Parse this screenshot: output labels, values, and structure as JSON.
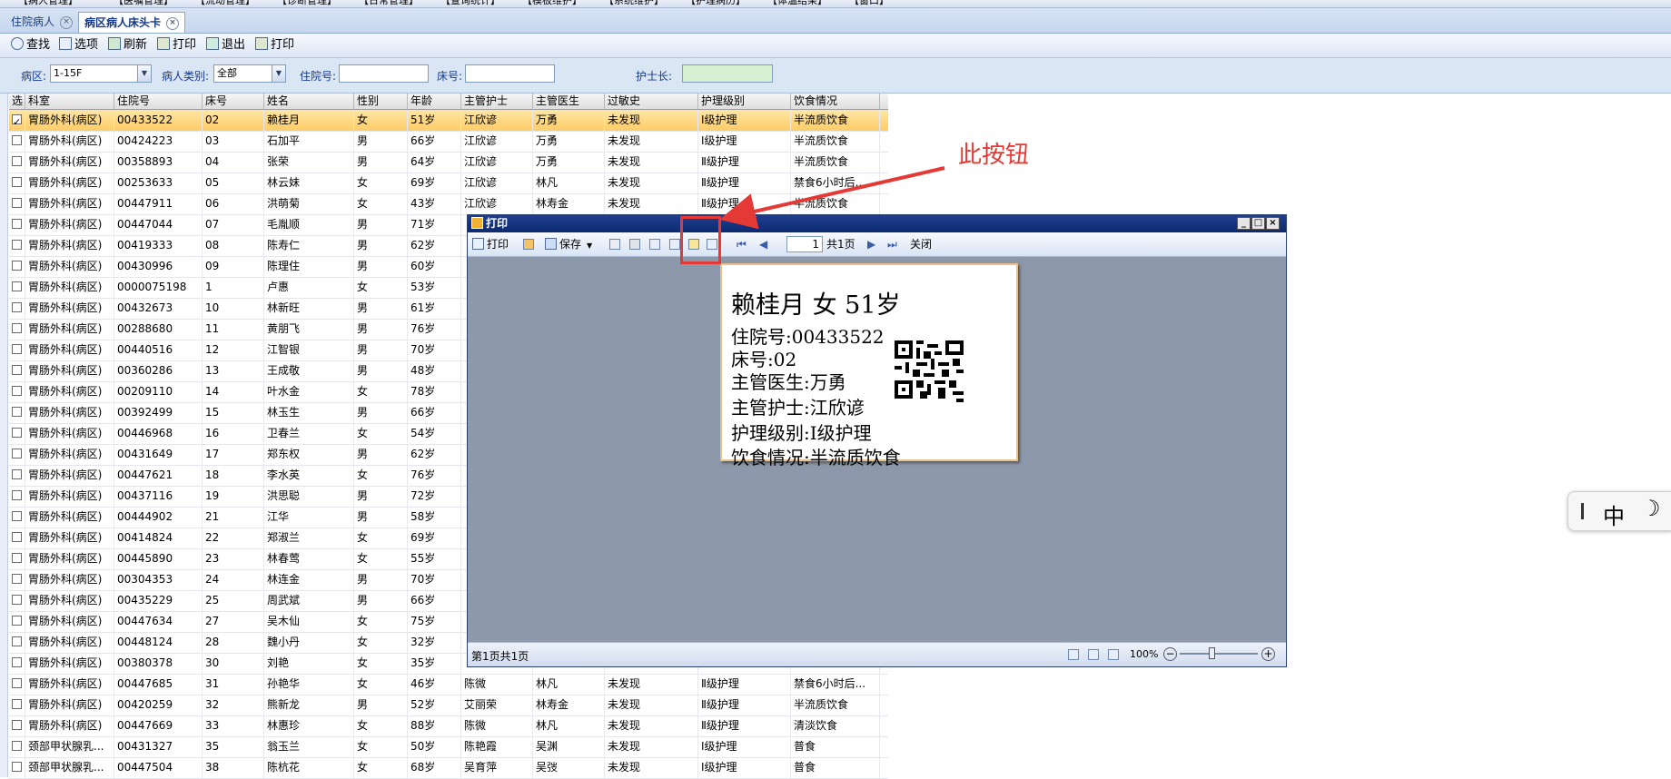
{
  "menubar": {
    "items": [
      "【病人管理】",
      "【医嘱管理】",
      "【流动管理】",
      "【诊断管理】",
      "【日常管理】",
      "【查询统计】",
      "【模板维护】",
      "【系统维护】",
      "【护理病历】",
      "【体温结果】",
      "【窗口】"
    ]
  },
  "tabs": [
    {
      "label": "住院病人",
      "active": false
    },
    {
      "label": "病区病人床头卡",
      "active": true
    }
  ],
  "toolbar": {
    "find": "查找",
    "options": "选项",
    "refresh": "刷新",
    "print1": "打印",
    "exit": "退出",
    "print2": "打印"
  },
  "filters": {
    "ward_label": "病区:",
    "ward_value": "1-15F",
    "type_label": "病人类别:",
    "type_value": "全部",
    "admission_label": "住院号:",
    "admission_value": "",
    "bed_label": "床号:",
    "bed_value": "",
    "head_nurse_label": "护士长:",
    "head_nurse_value": ""
  },
  "grid": {
    "columns": [
      "选",
      "科室",
      "住院号",
      "床号",
      "姓名",
      "性别",
      "年龄",
      "主管护士",
      "主管医生",
      "过敏史",
      "护理级别",
      "饮食情况"
    ],
    "rows": [
      {
        "checked": true,
        "cells": [
          "胃肠外科(病区)",
          "00433522",
          "02",
          "赖桂月",
          "女",
          "51岁",
          "江欣谚",
          "万勇",
          "未发现",
          "Ⅰ级护理",
          "半流质饮食"
        ]
      },
      {
        "checked": false,
        "cells": [
          "胃肠外科(病区)",
          "00424223",
          "03",
          "石加平",
          "男",
          "66岁",
          "江欣谚",
          "万勇",
          "未发现",
          "Ⅰ级护理",
          "半流质饮食"
        ]
      },
      {
        "checked": false,
        "cells": [
          "胃肠外科(病区)",
          "00358893",
          "04",
          "张荣",
          "男",
          "64岁",
          "江欣谚",
          "万勇",
          "未发现",
          "Ⅱ级护理",
          "半流质饮食"
        ]
      },
      {
        "checked": false,
        "cells": [
          "胃肠外科(病区)",
          "00253633",
          "05",
          "林云妹",
          "女",
          "69岁",
          "江欣谚",
          "林凡",
          "未发现",
          "Ⅱ级护理",
          "禁食6小时后..."
        ]
      },
      {
        "checked": false,
        "cells": [
          "胃肠外科(病区)",
          "00447911",
          "06",
          "洪萌菊",
          "女",
          "43岁",
          "江欣谚",
          "林寿金",
          "未发现",
          "Ⅱ级护理",
          "半流质饮食"
        ]
      },
      {
        "checked": false,
        "cells": [
          "胃肠外科(病区)",
          "00447044",
          "07",
          "毛胤顺",
          "男",
          "71岁",
          "",
          "",
          "",
          "",
          ""
        ]
      },
      {
        "checked": false,
        "cells": [
          "胃肠外科(病区)",
          "00419333",
          "08",
          "陈寿仁",
          "男",
          "62岁",
          "",
          "",
          "",
          "",
          ""
        ]
      },
      {
        "checked": false,
        "cells": [
          "胃肠外科(病区)",
          "00430996",
          "09",
          "陈理住",
          "男",
          "60岁",
          "",
          "",
          "",
          "",
          ""
        ]
      },
      {
        "checked": false,
        "cells": [
          "胃肠外科(病区)",
          "0000075198",
          "1",
          "卢惠",
          "女",
          "53岁",
          "",
          "",
          "",
          "",
          ""
        ]
      },
      {
        "checked": false,
        "cells": [
          "胃肠外科(病区)",
          "00432673",
          "10",
          "林新旺",
          "男",
          "61岁",
          "",
          "",
          "",
          "",
          ""
        ]
      },
      {
        "checked": false,
        "cells": [
          "胃肠外科(病区)",
          "00288680",
          "11",
          "黄朋飞",
          "男",
          "76岁",
          "",
          "",
          "",
          "",
          ""
        ]
      },
      {
        "checked": false,
        "cells": [
          "胃肠外科(病区)",
          "00440516",
          "12",
          "江智银",
          "男",
          "70岁",
          "",
          "",
          "",
          "",
          ""
        ]
      },
      {
        "checked": false,
        "cells": [
          "胃肠外科(病区)",
          "00360286",
          "13",
          "王成敬",
          "男",
          "48岁",
          "",
          "",
          "",
          "",
          ""
        ]
      },
      {
        "checked": false,
        "cells": [
          "胃肠外科(病区)",
          "00209110",
          "14",
          "叶水金",
          "女",
          "78岁",
          "",
          "",
          "",
          "",
          ""
        ]
      },
      {
        "checked": false,
        "cells": [
          "胃肠外科(病区)",
          "00392499",
          "15",
          "林玉生",
          "男",
          "66岁",
          "",
          "",
          "",
          "",
          ""
        ]
      },
      {
        "checked": false,
        "cells": [
          "胃肠外科(病区)",
          "00446968",
          "16",
          "卫春兰",
          "女",
          "54岁",
          "",
          "",
          "",
          "",
          ""
        ]
      },
      {
        "checked": false,
        "cells": [
          "胃肠外科(病区)",
          "00431649",
          "17",
          "郑东权",
          "男",
          "62岁",
          "",
          "",
          "",
          "",
          ""
        ]
      },
      {
        "checked": false,
        "cells": [
          "胃肠外科(病区)",
          "00447621",
          "18",
          "李水英",
          "女",
          "76岁",
          "",
          "",
          "",
          "",
          ""
        ]
      },
      {
        "checked": false,
        "cells": [
          "胃肠外科(病区)",
          "00437116",
          "19",
          "洪思聪",
          "男",
          "72岁",
          "",
          "",
          "",
          "",
          ""
        ]
      },
      {
        "checked": false,
        "cells": [
          "胃肠外科(病区)",
          "00444902",
          "21",
          "江华",
          "男",
          "58岁",
          "",
          "",
          "",
          "",
          ""
        ]
      },
      {
        "checked": false,
        "cells": [
          "胃肠外科(病区)",
          "00414824",
          "22",
          "郑淑兰",
          "女",
          "69岁",
          "",
          "",
          "",
          "",
          ""
        ]
      },
      {
        "checked": false,
        "cells": [
          "胃肠外科(病区)",
          "00445890",
          "23",
          "林春莺",
          "女",
          "55岁",
          "",
          "",
          "",
          "",
          ""
        ]
      },
      {
        "checked": false,
        "cells": [
          "胃肠外科(病区)",
          "00304353",
          "24",
          "林连金",
          "男",
          "70岁",
          "",
          "",
          "",
          "",
          ""
        ]
      },
      {
        "checked": false,
        "cells": [
          "胃肠外科(病区)",
          "00435229",
          "25",
          "周武斌",
          "男",
          "66岁",
          "",
          "",
          "",
          "",
          ""
        ]
      },
      {
        "checked": false,
        "cells": [
          "胃肠外科(病区)",
          "00447634",
          "27",
          "吴木仙",
          "女",
          "75岁",
          "",
          "",
          "",
          "",
          ""
        ]
      },
      {
        "checked": false,
        "cells": [
          "胃肠外科(病区)",
          "00448124",
          "28",
          "魏小丹",
          "女",
          "32岁",
          "",
          "",
          "",
          "",
          ""
        ]
      },
      {
        "checked": false,
        "cells": [
          "胃肠外科(病区)",
          "00380378",
          "30",
          "刘艳",
          "女",
          "35岁",
          "",
          "",
          "",
          "",
          ""
        ]
      },
      {
        "checked": false,
        "cells": [
          "胃肠外科(病区)",
          "00447685",
          "31",
          "孙艳华",
          "女",
          "46岁",
          "陈微",
          "林凡",
          "未发现",
          "Ⅱ级护理",
          "禁食6小时后..."
        ]
      },
      {
        "checked": false,
        "cells": [
          "胃肠外科(病区)",
          "00420259",
          "32",
          "熊新龙",
          "男",
          "52岁",
          "艾丽荣",
          "林寿金",
          "未发现",
          "Ⅱ级护理",
          "半流质饮食"
        ]
      },
      {
        "checked": false,
        "cells": [
          "胃肠外科(病区)",
          "00447669",
          "33",
          "林惠珍",
          "女",
          "88岁",
          "陈微",
          "林凡",
          "未发现",
          "Ⅱ级护理",
          "清淡饮食"
        ]
      },
      {
        "checked": false,
        "cells": [
          "颈部甲状腺乳...",
          "00431327",
          "35",
          "翁玉兰",
          "女",
          "50岁",
          "陈艳霞",
          "吴渊",
          "未发现",
          "Ⅰ级护理",
          "普食"
        ]
      },
      {
        "checked": false,
        "cells": [
          "颈部甲状腺乳...",
          "00447504",
          "38",
          "陈杭花",
          "女",
          "68岁",
          "吴育萍",
          "吴弢",
          "未发现",
          "Ⅰ级护理",
          "普食"
        ]
      }
    ]
  },
  "print_window": {
    "title": "打印",
    "print_label": "打印",
    "save_label": "保存",
    "page_value": "1",
    "page_total": "共1页",
    "close_label": "关闭",
    "status_text": "第1页共1页",
    "zoom": "100%",
    "card": {
      "header": "赖桂月  女  51岁",
      "lines": [
        "住院号:00433522",
        "床号:02",
        "主管医生:万勇",
        "主管护士:江欣谚",
        "护理级别:Ⅰ级护理",
        "饮食情况:半流质饮食"
      ]
    }
  },
  "annotation": {
    "text": "此按钮",
    "color": "#e53935"
  },
  "ime": {
    "mode": "中"
  }
}
